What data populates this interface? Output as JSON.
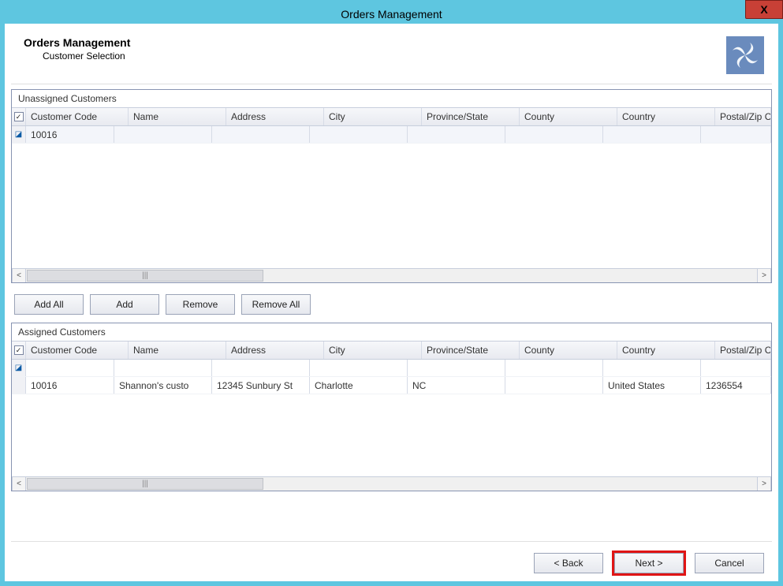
{
  "window": {
    "title": "Orders Management"
  },
  "header": {
    "title": "Orders Management",
    "subtitle": "Customer Selection"
  },
  "columns": {
    "code": "Customer Code",
    "name": "Name",
    "address": "Address",
    "city": "City",
    "province": "Province/State",
    "county": "County",
    "country": "Country",
    "postal": "Postal/Zip C"
  },
  "panels": {
    "unassigned_title": "Unassigned Customers",
    "assigned_title": "Assigned Customers"
  },
  "unassigned": {
    "rows": [
      {
        "code": "10016",
        "name": "",
        "address": "",
        "city": "",
        "province": "",
        "county": "",
        "country": "",
        "postal": "",
        "checked": true
      }
    ]
  },
  "assigned": {
    "rows": [
      {
        "code": "",
        "name": "",
        "address": "",
        "city": "",
        "province": "",
        "county": "",
        "country": "",
        "postal": "",
        "checked": false,
        "marked": true
      },
      {
        "code": "10016",
        "name": "Shannon's custo",
        "address": "12345 Sunbury St",
        "city": "Charlotte",
        "province": "NC",
        "county": "",
        "country": "United States",
        "postal": "1236554",
        "checked": false
      }
    ]
  },
  "buttons": {
    "add_all": "Add All",
    "add": "Add",
    "remove": "Remove",
    "remove_all": "Remove All",
    "back": "< Back",
    "next": "Next >",
    "cancel": "Cancel"
  },
  "scroll_thumb_glyph": "|||"
}
